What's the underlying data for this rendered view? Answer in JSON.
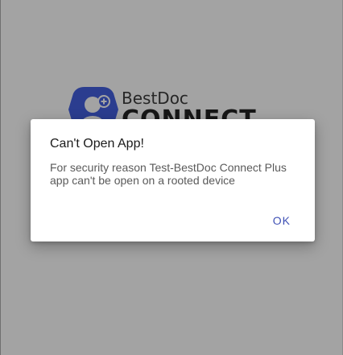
{
  "splash": {
    "brand": "BestDoc",
    "product": "CONNECT",
    "logo_icon": "doctor-avatar-plus-icon",
    "brand_color": "#2b3d8f"
  },
  "dialog": {
    "title": "Can't Open App!",
    "message": "For security reason Test-BestDoc Connect Plus app can't be open on a rooted device",
    "ok_label": "OK",
    "accent_color": "#3f51b5"
  }
}
